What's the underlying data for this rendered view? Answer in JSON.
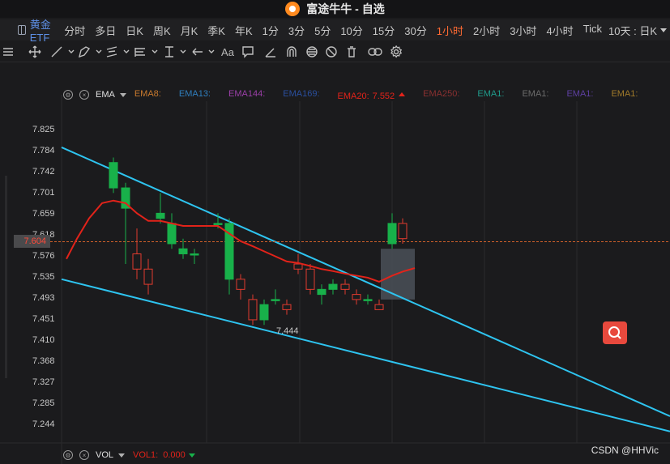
{
  "window": {
    "title": "富途牛牛 - 自选",
    "logo_icon": "futu-logo-icon"
  },
  "timebar": {
    "symbol": "黄金ETF",
    "periods": [
      "分时",
      "多日",
      "日K",
      "周K",
      "月K",
      "季K",
      "年K",
      "1分",
      "3分",
      "5分",
      "10分",
      "15分",
      "30分",
      "1小时",
      "2小时",
      "3小时",
      "4小时",
      "Tick"
    ],
    "active_period": "1小时",
    "range_select": "10天 : 日K"
  },
  "toolbar": {
    "tools": [
      "crosshair-icon",
      "line-icon",
      "pen-icon",
      "channel-icon",
      "fib-icon",
      "measure-icon",
      "arrow-icon",
      "text-icon",
      "note-icon",
      "brush-icon",
      "magnet-icon",
      "visibility-icon",
      "eraser-icon",
      "trash-icon",
      "link-icon",
      "settings-icon"
    ],
    "text_tool_label": "Aa"
  },
  "indicator": {
    "name": "EMA",
    "entries": [
      {
        "label": "EMA8:",
        "value": "",
        "color": "#c87a2e"
      },
      {
        "label": "EMA13:",
        "value": "",
        "color": "#2f7fbf"
      },
      {
        "label": "EMA144:",
        "value": "",
        "color": "#9b3fa8"
      },
      {
        "label": "EMA169:",
        "value": "",
        "color": "#2a4f9e"
      },
      {
        "label": "EMA20:",
        "value": "7.552",
        "color": "#e2231a"
      },
      {
        "label": "EMA250:",
        "value": "",
        "color": "#8a3030"
      },
      {
        "label": "EMA1:",
        "value": "",
        "color": "#1f9a8a"
      },
      {
        "label": "EMA1:",
        "value": "",
        "color": "#6b6b6b"
      },
      {
        "label": "EMA1:",
        "value": "",
        "color": "#5d3fa0"
      },
      {
        "label": "EMA1:",
        "value": "",
        "color": "#a07a2a"
      }
    ]
  },
  "volume": {
    "name": "VOL",
    "label": "VOL1:",
    "value": "0.000",
    "color": "#e2231a"
  },
  "price_axis": {
    "ticks": [
      "7.825",
      "7.784",
      "7.742",
      "7.701",
      "7.659",
      "7.618",
      "7.576",
      "7.535",
      "7.493",
      "7.451",
      "7.410",
      "7.368",
      "7.327",
      "7.285",
      "7.244"
    ],
    "current_price": "7.604"
  },
  "annotations": {
    "low_label": "7.444"
  },
  "colors": {
    "up": "#18b14a",
    "down": "#e23b2e",
    "trendline": "#2ec4f0",
    "ema20": "#e2231a",
    "grid": "#2b2b2d"
  },
  "watermark": "CSDN @HHVic",
  "chart_data": {
    "type": "candlestick",
    "ylim": [
      7.22,
      7.85
    ],
    "candles": [
      {
        "o": 7.71,
        "c": 7.76,
        "h": 7.77,
        "l": 7.7
      },
      {
        "o": 7.67,
        "c": 7.71,
        "h": 7.72,
        "l": 7.56
      },
      {
        "o": 7.58,
        "c": 7.55,
        "h": 7.63,
        "l": 7.53
      },
      {
        "o": 7.55,
        "c": 7.52,
        "h": 7.57,
        "l": 7.5
      },
      {
        "o": 7.65,
        "c": 7.66,
        "h": 7.7,
        "l": 7.64
      },
      {
        "o": 7.6,
        "c": 7.64,
        "h": 7.66,
        "l": 7.59
      },
      {
        "o": 7.58,
        "c": 7.59,
        "h": 7.61,
        "l": 7.57
      },
      {
        "o": 7.58,
        "c": 7.58,
        "h": 7.59,
        "l": 7.56
      },
      {
        "o": 7.64,
        "c": 7.64,
        "h": 7.66,
        "l": 7.63
      },
      {
        "o": 7.53,
        "c": 7.64,
        "h": 7.65,
        "l": 7.5
      },
      {
        "o": 7.53,
        "c": 7.51,
        "h": 7.54,
        "l": 7.49
      },
      {
        "o": 7.49,
        "c": 7.45,
        "h": 7.5,
        "l": 7.44
      },
      {
        "o": 7.45,
        "c": 7.48,
        "h": 7.49,
        "l": 7.44
      },
      {
        "o": 7.49,
        "c": 7.49,
        "h": 7.51,
        "l": 7.48
      },
      {
        "o": 7.48,
        "c": 7.47,
        "h": 7.49,
        "l": 7.46
      },
      {
        "o": 7.56,
        "c": 7.55,
        "h": 7.58,
        "l": 7.54
      },
      {
        "o": 7.55,
        "c": 7.51,
        "h": 7.56,
        "l": 7.5
      },
      {
        "o": 7.5,
        "c": 7.51,
        "h": 7.52,
        "l": 7.48
      },
      {
        "o": 7.51,
        "c": 7.52,
        "h": 7.53,
        "l": 7.5
      },
      {
        "o": 7.52,
        "c": 7.51,
        "h": 7.53,
        "l": 7.5
      },
      {
        "o": 7.5,
        "c": 7.49,
        "h": 7.51,
        "l": 7.48
      },
      {
        "o": 7.49,
        "c": 7.49,
        "h": 7.5,
        "l": 7.48
      },
      {
        "o": 7.48,
        "c": 7.47,
        "h": 7.49,
        "l": 7.47
      },
      {
        "o": 7.6,
        "c": 7.64,
        "h": 7.66,
        "l": 7.59
      },
      {
        "o": 7.64,
        "c": 7.61,
        "h": 7.65,
        "l": 7.6
      }
    ],
    "candle_x": [
      140,
      155,
      169,
      183,
      198,
      212,
      226,
      240,
      269,
      283,
      297,
      312,
      326,
      340,
      354,
      368,
      383,
      397,
      411,
      426,
      440,
      454,
      468,
      484,
      497
    ],
    "ema20": [
      [
        82,
        7.57
      ],
      [
        95,
        7.61
      ],
      [
        110,
        7.65
      ],
      [
        126,
        7.68
      ],
      [
        140,
        7.685
      ],
      [
        155,
        7.68
      ],
      [
        169,
        7.66
      ],
      [
        183,
        7.645
      ],
      [
        198,
        7.645
      ],
      [
        212,
        7.64
      ],
      [
        226,
        7.635
      ],
      [
        240,
        7.635
      ],
      [
        254,
        7.635
      ],
      [
        269,
        7.635
      ],
      [
        283,
        7.62
      ],
      [
        297,
        7.605
      ],
      [
        312,
        7.595
      ],
      [
        326,
        7.585
      ],
      [
        340,
        7.575
      ],
      [
        354,
        7.565
      ],
      [
        368,
        7.562
      ],
      [
        383,
        7.556
      ],
      [
        397,
        7.55
      ],
      [
        411,
        7.546
      ],
      [
        426,
        7.541
      ],
      [
        440,
        7.537
      ],
      [
        454,
        7.533
      ],
      [
        468,
        7.525
      ],
      [
        484,
        7.537
      ],
      [
        497,
        7.545
      ],
      [
        512,
        7.552
      ]
    ],
    "trendlines": [
      {
        "from": [
          76,
          7.79
        ],
        "to": [
          827,
          7.26
        ]
      },
      {
        "from": [
          76,
          7.53
        ],
        "to": [
          827,
          7.23
        ]
      }
    ],
    "highlight_box": {
      "x0": 470,
      "x1": 512,
      "y0": 7.49,
      "y1": 7.59
    },
    "current_price": 7.604
  }
}
